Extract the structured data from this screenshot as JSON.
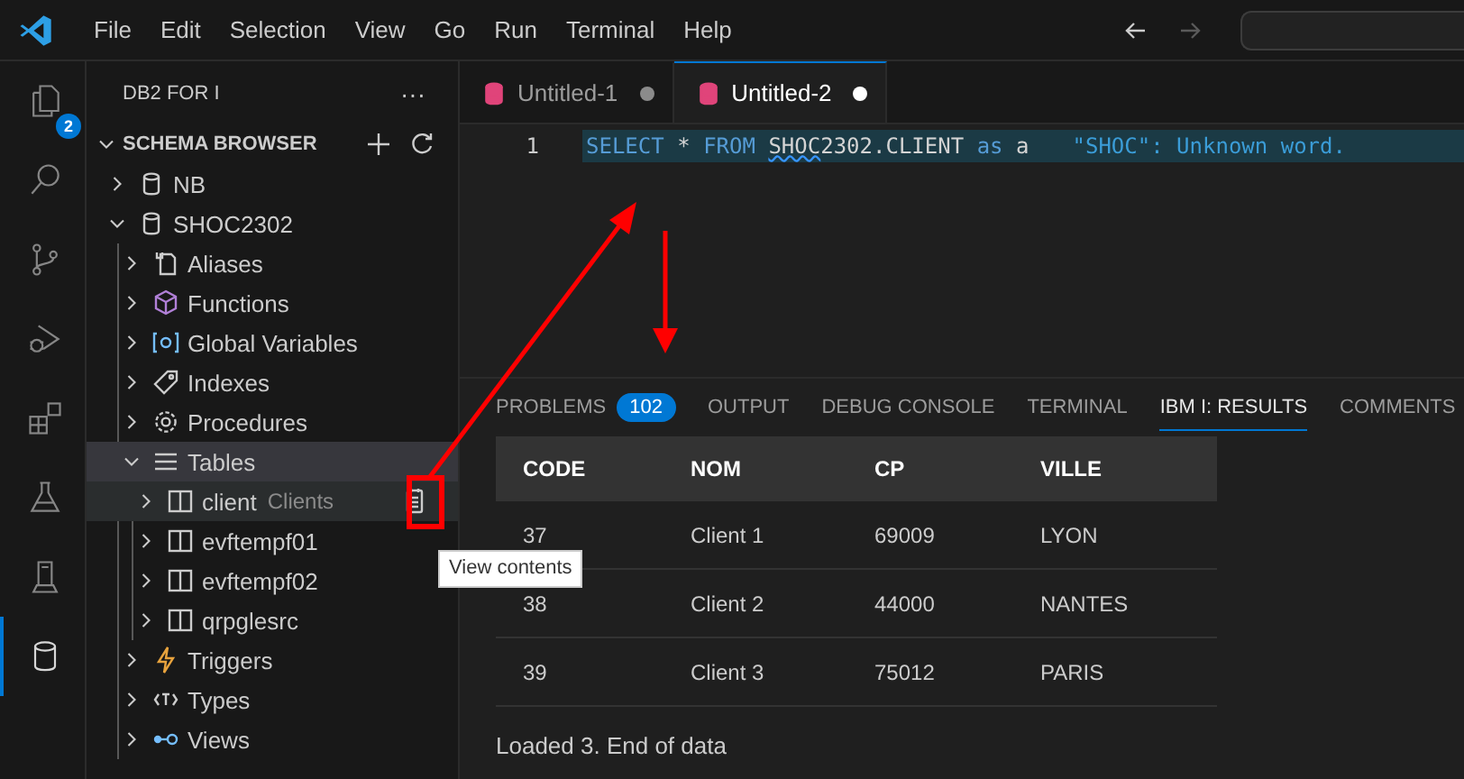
{
  "menu": [
    "File",
    "Edit",
    "Selection",
    "View",
    "Go",
    "Run",
    "Terminal",
    "Help"
  ],
  "nav": {
    "back_enabled": true,
    "forward_enabled": false
  },
  "activity_bar": [
    {
      "kind": "files",
      "selected": false,
      "badge": "2"
    },
    {
      "kind": "search",
      "selected": false
    },
    {
      "kind": "source-control",
      "selected": false
    },
    {
      "kind": "run-debug",
      "selected": false
    },
    {
      "kind": "extensions",
      "selected": false
    },
    {
      "kind": "flask",
      "selected": false
    },
    {
      "kind": "ibmi",
      "selected": false
    },
    {
      "kind": "database",
      "selected": true
    }
  ],
  "sidebar": {
    "title": "DB2 FOR I",
    "more": "···",
    "section": {
      "title": "SCHEMA BROWSER",
      "expanded": true,
      "tree": [
        {
          "label": "NB",
          "kind": "database",
          "expanded": false,
          "selected": false
        },
        {
          "label": "SHOC2302",
          "kind": "database",
          "expanded": true,
          "selected": false,
          "children": [
            {
              "label": "Aliases",
              "kind": "alias",
              "expanded": false,
              "selected": false
            },
            {
              "label": "Functions",
              "kind": "function",
              "expanded": false,
              "selected": false
            },
            {
              "label": "Global Variables",
              "kind": "variable",
              "expanded": false,
              "selected": false
            },
            {
              "label": "Indexes",
              "kind": "index",
              "expanded": false,
              "selected": false
            },
            {
              "label": "Procedures",
              "kind": "procedure",
              "expanded": false,
              "selected": false
            },
            {
              "label": "Tables",
              "kind": "list",
              "expanded": true,
              "selected": true,
              "children": [
                {
                  "label": "client",
                  "description": "Clients",
                  "kind": "table",
                  "expanded": false,
                  "selected": true,
                  "action": true
                },
                {
                  "label": "evftempf01",
                  "kind": "table",
                  "expanded": false,
                  "selected": false
                },
                {
                  "label": "evftempf02",
                  "kind": "table",
                  "expanded": false,
                  "selected": false
                },
                {
                  "label": "qrpglesrc",
                  "kind": "table",
                  "expanded": false,
                  "selected": false
                }
              ]
            },
            {
              "label": "Triggers",
              "kind": "trigger",
              "expanded": false,
              "selected": false
            },
            {
              "label": "Types",
              "kind": "type",
              "expanded": false,
              "selected": false
            },
            {
              "label": "Views",
              "kind": "view",
              "expanded": false,
              "selected": false
            }
          ]
        }
      ]
    }
  },
  "tooltip": "View contents",
  "editor_tabs": [
    {
      "label": "Untitled-1",
      "selected": false,
      "modified": true
    },
    {
      "label": "Untitled-2",
      "selected": true,
      "modified": true
    }
  ],
  "editor": {
    "lines": [
      {
        "number": "1",
        "tokens": [
          {
            "kind": "keyword",
            "text": "SELECT"
          },
          {
            "kind": "operator",
            "text": "*",
            "attached": false
          },
          {
            "kind": "keyword",
            "text": "FROM",
            "attached": false
          },
          {
            "kind": "squiggle",
            "text": "SHOC",
            "attached": false
          },
          {
            "kind": "plain",
            "text": "2302.CLIENT",
            "attached": true
          },
          {
            "kind": "keyword",
            "text": "as",
            "attached": false
          },
          {
            "kind": "plain",
            "text": "a",
            "attached": false
          }
        ],
        "hint": "\"SHOC\": Unknown word."
      }
    ]
  },
  "panel": {
    "tabs": [
      {
        "label": "PROBLEMS",
        "badge": "102",
        "selected": false
      },
      {
        "label": "OUTPUT",
        "selected": false
      },
      {
        "label": "DEBUG CONSOLE",
        "selected": false
      },
      {
        "label": "TERMINAL",
        "selected": false
      },
      {
        "label": "IBM I: RESULTS",
        "selected": true
      },
      {
        "label": "COMMENTS",
        "selected": false
      }
    ],
    "table": {
      "columns": [
        "CODE",
        "NOM",
        "CP",
        "VILLE"
      ],
      "rows": [
        [
          "37",
          "Client 1",
          "69009",
          "LYON"
        ],
        [
          "38",
          "Client 2",
          "44000",
          "NANTES"
        ],
        [
          "39",
          "Client 3",
          "75012",
          "PARIS"
        ]
      ]
    },
    "status": "Loaded 3. End of data"
  }
}
